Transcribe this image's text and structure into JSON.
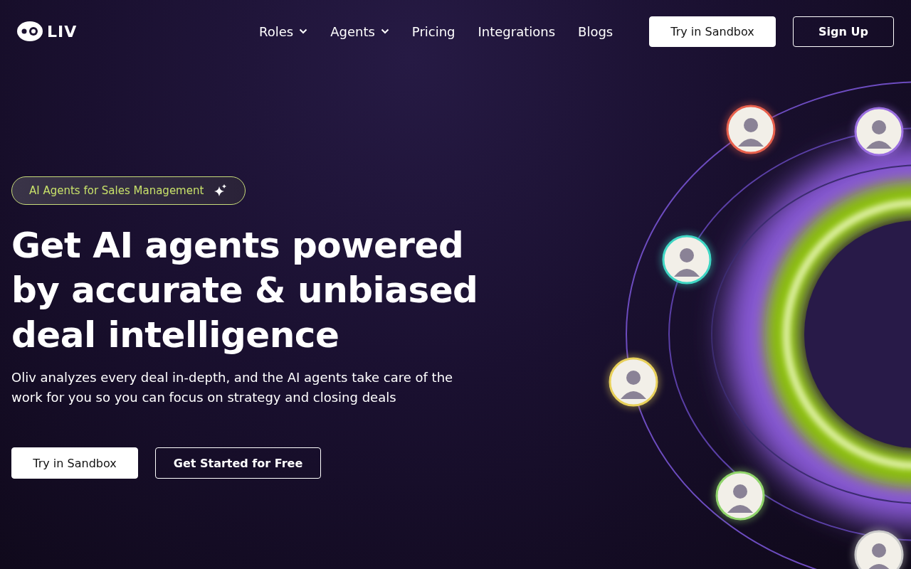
{
  "logo": {
    "text": "LIV"
  },
  "nav": [
    {
      "label": "Roles",
      "kind": "dropdown"
    },
    {
      "label": "Agents",
      "kind": "dropdown"
    },
    {
      "label": "Pricing",
      "kind": "link"
    },
    {
      "label": "Integrations",
      "kind": "link"
    },
    {
      "label": "Blogs",
      "kind": "link"
    }
  ],
  "header_buttons": [
    {
      "label": "Try in Sandbox",
      "kind": "primary"
    },
    {
      "label": "Sign Up",
      "kind": "outline"
    }
  ],
  "badge": {
    "text": "AI Agents for Sales Management"
  },
  "headline": "Get AI agents powered by accurate & unbiased deal intelligence",
  "subtitle": "Oliv analyzes every deal in-depth, and the AI agents take care of the work for you so you can focus on strategy and closing deals",
  "cta_buttons": [
    {
      "label": "Try in Sandbox",
      "kind": "primary"
    },
    {
      "label": "Get Started for Free",
      "kind": "outline"
    }
  ],
  "avatars": [
    {
      "color": "#e8604c"
    },
    {
      "color": "#9b6fe0"
    },
    {
      "color": "#3fd6c4"
    },
    {
      "color": "#e8d05a"
    },
    {
      "color": "#8fd46a"
    },
    {
      "color": "#c8c8c8"
    }
  ]
}
